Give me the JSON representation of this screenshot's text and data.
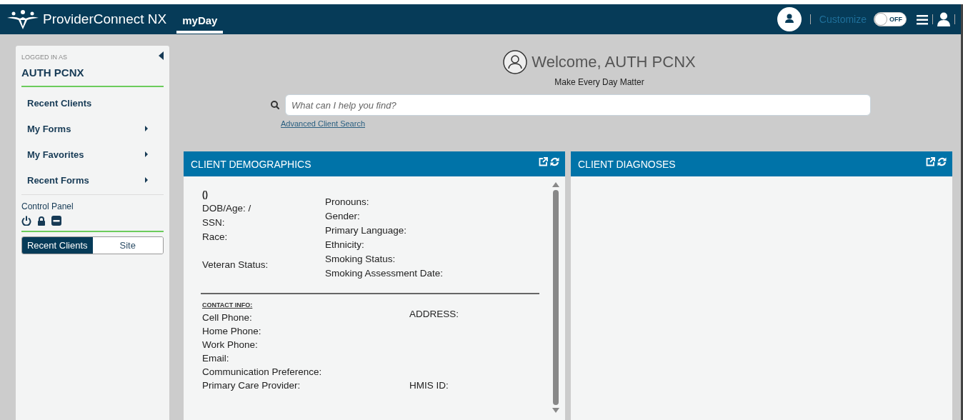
{
  "header": {
    "brand": "ProviderConnect NX",
    "nav_tab": {
      "label": "myDay",
      "selected": true
    },
    "customize_label": "Customize",
    "toggle": {
      "label": "OFF",
      "on": false
    }
  },
  "sidebar": {
    "logged_in_label": "LOGGED IN AS",
    "user_name": "AUTH PCNX",
    "items": [
      {
        "label": "Recent Clients",
        "has_submenu": false
      },
      {
        "label": "My Forms",
        "has_submenu": true
      },
      {
        "label": "My Favorites",
        "has_submenu": true
      },
      {
        "label": "Recent Forms",
        "has_submenu": true
      }
    ],
    "control_panel_label": "Control Panel",
    "segments": [
      {
        "label": "Recent Clients",
        "selected": true
      },
      {
        "label": "Site",
        "selected": false
      }
    ]
  },
  "welcome": {
    "title": "Welcome, AUTH PCNX",
    "subtitle": "Make Every Day Matter",
    "search_placeholder": "What can I help you find?",
    "advanced_link": "Advanced Client Search"
  },
  "panels": [
    {
      "kind": "demographics",
      "title": "CLIENT DEMOGRAPHICS",
      "name_line": "()",
      "left_fields": [
        "DOB/Age: /",
        "SSN:",
        "Race:",
        "Veteran Status:"
      ],
      "right_fields": [
        "Pronouns:",
        "Gender:",
        "Primary Language:",
        "Ethnicity:",
        "Smoking Status:",
        "Smoking Assessment Date:"
      ],
      "contact_heading": "CONTACT INFO:",
      "contact_fields": [
        "Cell Phone:",
        "Home Phone:",
        "Work Phone:",
        "Email:",
        "Communication Preference:",
        "Primary Care Provider:"
      ],
      "address_fields": [
        "ADDRESS:",
        "HMIS ID:"
      ]
    },
    {
      "kind": "empty",
      "title": "CLIENT DIAGNOSES"
    }
  ]
}
